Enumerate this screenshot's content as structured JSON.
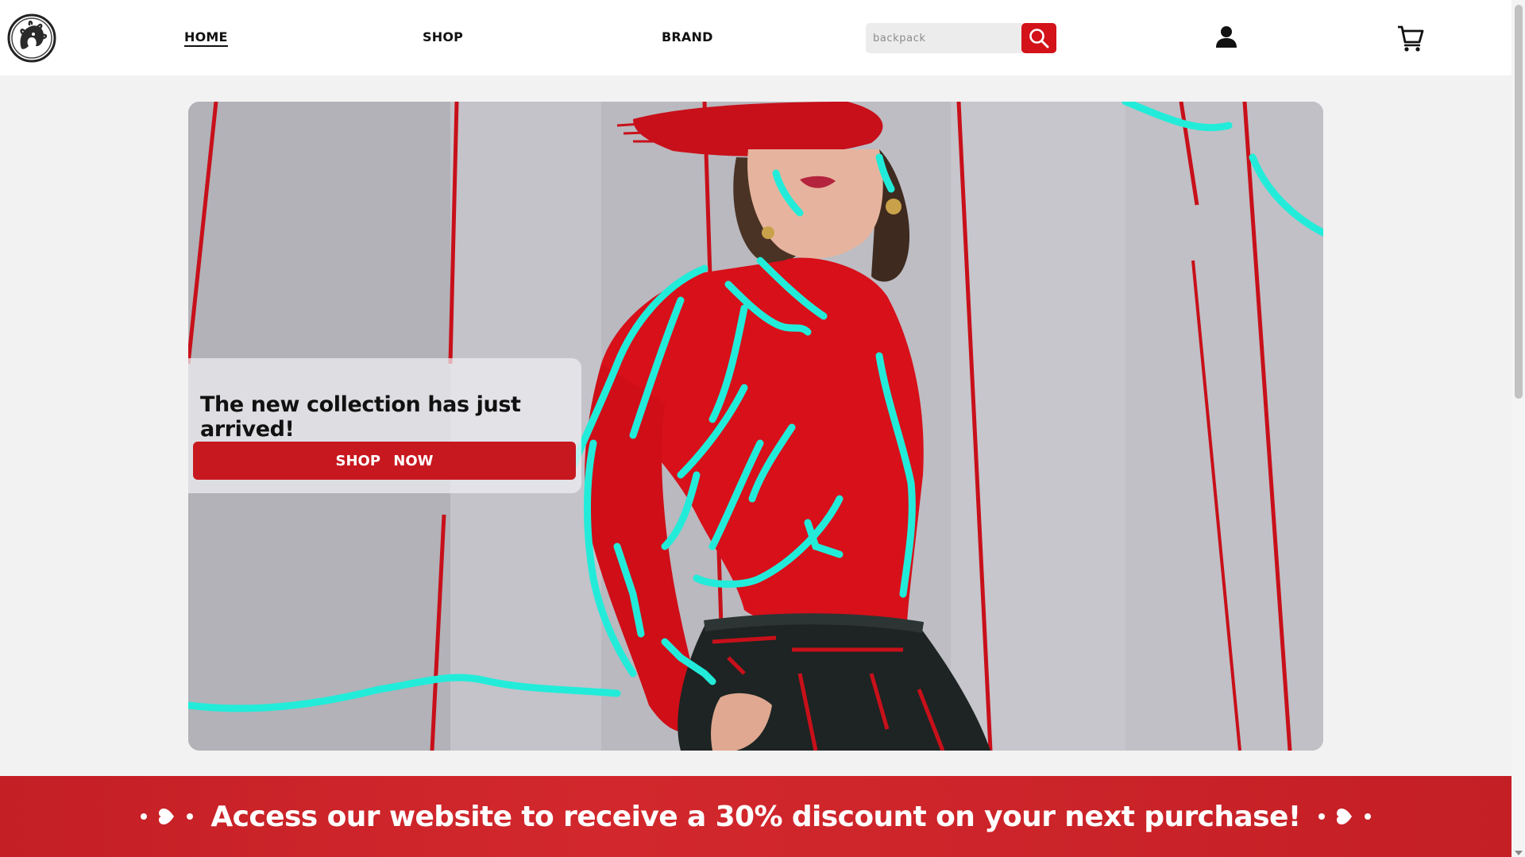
{
  "brand": {
    "logo_icon": "medusa-coin-logo-icon"
  },
  "nav": {
    "items": [
      {
        "label": "HOME",
        "active": true
      },
      {
        "label": "SHOP",
        "active": false
      },
      {
        "label": "BRAND",
        "active": false
      }
    ]
  },
  "search": {
    "placeholder": "backpack",
    "value": "",
    "button_icon": "search-icon"
  },
  "header_icons": {
    "account": "user-icon",
    "cart": "cart-icon"
  },
  "hero": {
    "title": "The new collection has just arrived!",
    "cta_label": "SHOP   NOW"
  },
  "banner": {
    "text": "Access our website to receive a 30% discount on your next purchase!",
    "decoration_icon": "heart-icon"
  },
  "colors": {
    "accent": "#d3121a",
    "banner": "#c8202a",
    "highlight": "#22ecd9",
    "header_bg": "#ffffff",
    "page_bg": "#f2f2f2"
  }
}
